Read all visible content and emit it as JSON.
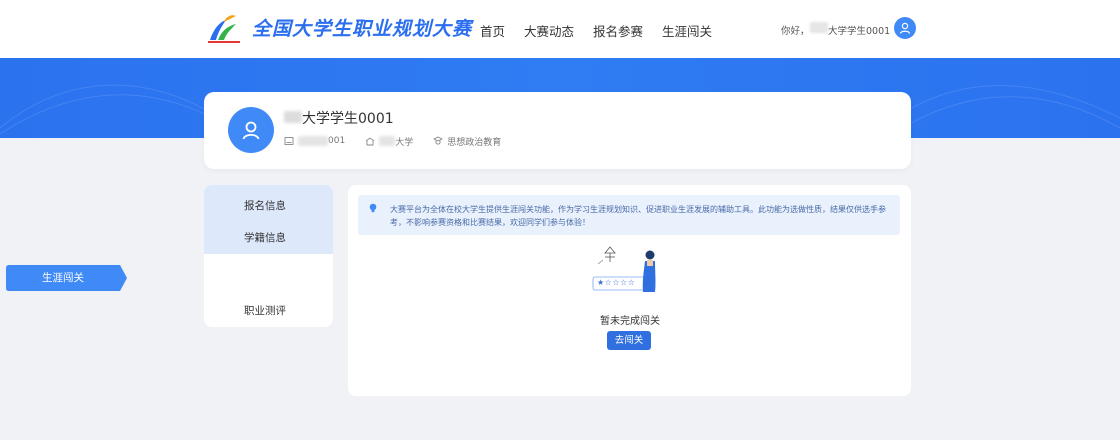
{
  "header": {
    "brand": "全国大学生职业规划大赛",
    "nav": [
      "首页",
      "大赛动态",
      "报名参赛",
      "生涯闯关"
    ],
    "greeting": "你好，",
    "user": "大学学生0001"
  },
  "profile": {
    "name": "大学学生0001",
    "student_id": "001",
    "school": "大学",
    "major": "思想政治教育"
  },
  "sidebar": {
    "items": [
      "报名信息",
      "学籍信息",
      "生涯闯关",
      "职业测评"
    ]
  },
  "main": {
    "notice": "大赛平台为全体在校大学生提供生涯闯关功能，作为学习生涯规划知识、促进职业生涯发展的辅助工具。此功能为选做性质，结果仅供选手参考，不影响参赛资格和比赛结果，欢迎同学们参与体验！",
    "empty_text": "暂未完成闯关",
    "go_button": "去闯关",
    "rating": "★☆☆☆☆"
  },
  "colors": {
    "primary": "#2b72ef",
    "accent_blue": "#3f8af7",
    "button": "#2f6fe0",
    "notice_bg": "#e9f1fc"
  }
}
